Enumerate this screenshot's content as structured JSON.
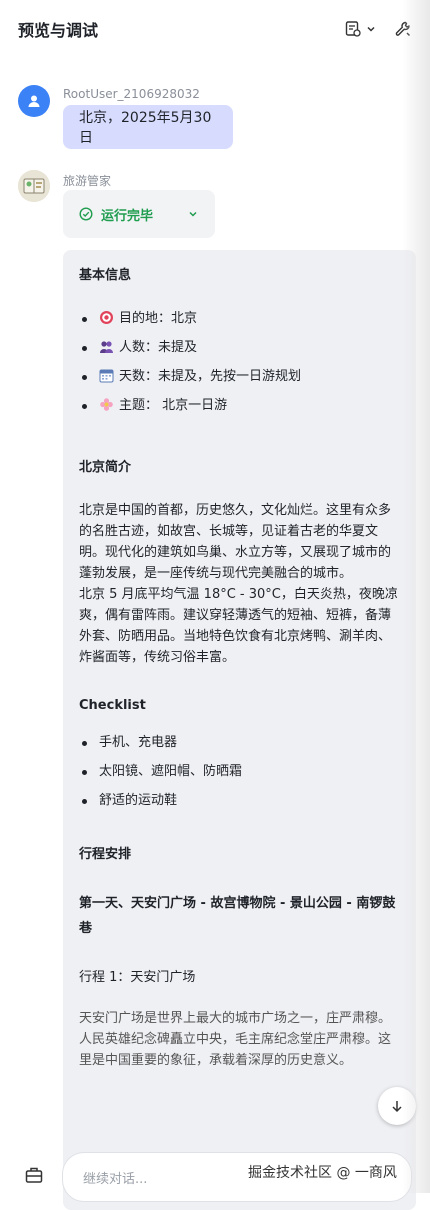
{
  "header": {
    "title": "预览与调试",
    "icons": [
      "document-settings-icon",
      "chevron-down-icon",
      "wrench-icon"
    ]
  },
  "user_message": {
    "username": "RootUser_2106928032",
    "text": "北京，2025年5月30日"
  },
  "bot_message": {
    "name": "旅游管家",
    "status": "运行完毕",
    "sections": {
      "basic_title": "基本信息",
      "basic_items": [
        {
          "icon": "target-icon",
          "text": "目的地：北京"
        },
        {
          "icon": "people-icon",
          "text": "人数：未提及"
        },
        {
          "icon": "calendar-icon",
          "text": "天数：未提及，先按一日游规划"
        },
        {
          "icon": "flower-icon",
          "text": "主题： 北京一日游"
        }
      ],
      "intro_title": "北京简介",
      "intro_p1": "北京是中国的首都，历史悠久，文化灿烂。这里有众多的名胜古迹，如故宫、长城等，见证着古老的华夏文明。现代化的建筑如鸟巢、水立方等，又展现了城市的蓬勃发展，是一座传统与现代完美融合的城市。",
      "intro_p2": "北京 5 月底平均气温 18°C - 30°C，白天炎热，夜晚凉爽，偶有雷阵雨。建议穿轻薄透气的短袖、短裤，备薄外套、防晒用品。当地特色饮食有北京烤鸭、涮羊肉、炸酱面等，传统习俗丰富。",
      "checklist_title": "Checklist",
      "checklist_items": [
        "手机、充电器",
        "太阳镜、遮阳帽、防晒霜",
        "舒适的运动鞋"
      ],
      "schedule_title": "行程安排",
      "day1_title": "第一天、天安门广场 - 故宫博物院 - 景山公园 - 南锣鼓巷",
      "trip1_title": "行程 1：天安门广场",
      "trip1_text": "天安门广场是世界上最大的城市广场之一，庄严肃穆。人民英雄纪念碑矗立中央，毛主席纪念堂庄严肃穆。这里是中国重要的象征，承载着深厚的历史意义。"
    }
  },
  "input": {
    "placeholder": "继续对话..."
  },
  "watermark": "掘金技术社区 @ 一商风",
  "colors": {
    "user_bubble": "#d7dcff",
    "status_green": "#1f9d4f",
    "answer_bg": "#eff0f4",
    "user_avatar": "#3b82f6"
  }
}
